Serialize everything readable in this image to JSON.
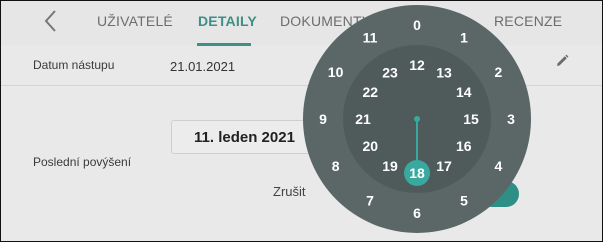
{
  "tabs": [
    {
      "label": "UŽIVATELÉ",
      "active": false
    },
    {
      "label": "DETAILY",
      "active": true
    },
    {
      "label": "DOKUMENTY",
      "active": false
    },
    {
      "label": "RECENZE",
      "active": false
    }
  ],
  "details": {
    "start_label": "Datum nástupu",
    "start_value": "21.01.2021",
    "promo_label": "Poslední povýšení",
    "date_field_value": "11. leden 2021"
  },
  "dialog": {
    "cancel_label": "Zrušit"
  },
  "clock": {
    "selected_hour": 18,
    "outer_hours": [
      "0",
      "1",
      "2",
      "3",
      "4",
      "5",
      "6",
      "7",
      "8",
      "9",
      "10",
      "11"
    ],
    "inner_hours": [
      "12",
      "13",
      "14",
      "15",
      "16",
      "17",
      "18",
      "19",
      "20",
      "21",
      "22",
      "23"
    ],
    "accent_color": "#39a89e",
    "face_color": "#5a6766",
    "inner_face_color": "#4f5b5a"
  },
  "icons": {
    "back": "chevron-left-icon",
    "edit": "pencil-icon"
  }
}
